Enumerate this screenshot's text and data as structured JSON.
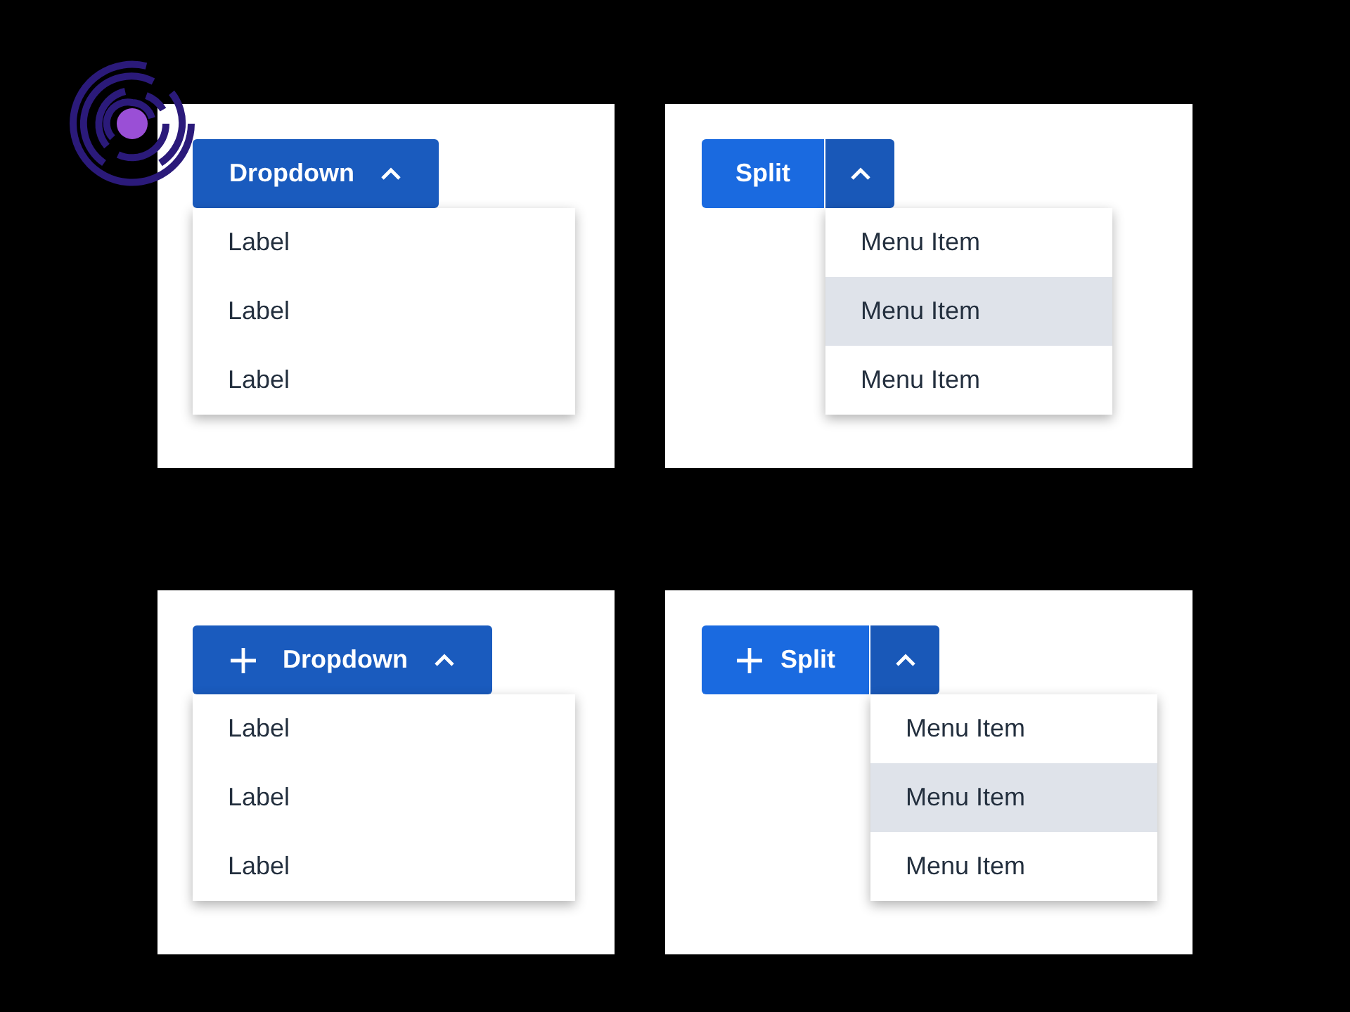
{
  "panels": [
    {
      "kind": "dropdown",
      "plus_icon": false,
      "label": "Dropdown",
      "items": [
        {
          "label": "Label",
          "selected": false
        },
        {
          "label": "Label",
          "selected": false
        },
        {
          "label": "Label",
          "selected": false
        }
      ]
    },
    {
      "kind": "split",
      "plus_icon": false,
      "label": "Split",
      "items": [
        {
          "label": "Menu Item",
          "selected": false
        },
        {
          "label": "Menu Item",
          "selected": true
        },
        {
          "label": "Menu Item",
          "selected": false
        }
      ]
    },
    {
      "kind": "dropdown",
      "plus_icon": true,
      "label": "Dropdown",
      "items": [
        {
          "label": "Label",
          "selected": false
        },
        {
          "label": "Label",
          "selected": false
        },
        {
          "label": "Label",
          "selected": false
        }
      ]
    },
    {
      "kind": "split",
      "plus_icon": true,
      "label": "Split",
      "items": [
        {
          "label": "Menu Item",
          "selected": false
        },
        {
          "label": "Menu Item",
          "selected": true
        },
        {
          "label": "Menu Item",
          "selected": false
        }
      ]
    }
  ]
}
